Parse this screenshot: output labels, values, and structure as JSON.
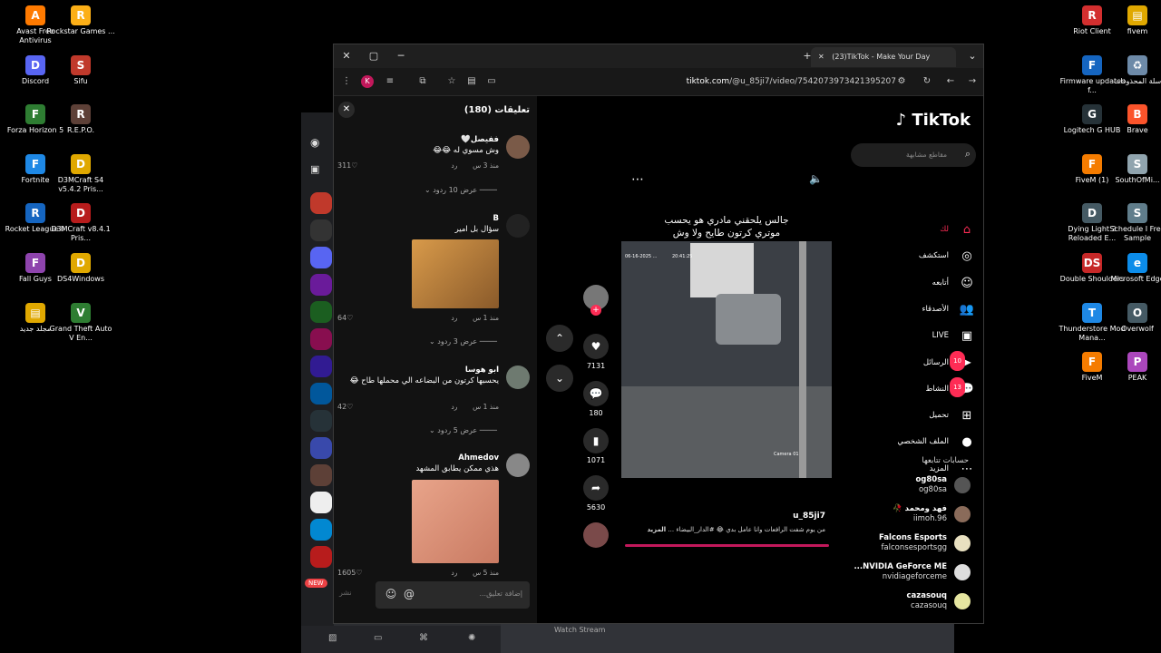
{
  "desktop_left": [
    {
      "label": "Avast Free Antivirus",
      "color": "#ff7a00",
      "glyph": "A"
    },
    {
      "label": "Rockstar Games ...",
      "color": "#fcaf17",
      "glyph": "R"
    },
    {
      "label": "Discord",
      "color": "#5865f2",
      "glyph": "D"
    },
    {
      "label": "Sifu",
      "color": "#c0392b",
      "glyph": "S"
    },
    {
      "label": "Forza Horizon 5",
      "color": "#2e7d32",
      "glyph": "F"
    },
    {
      "label": "R.E.P.O.",
      "color": "#5d4037",
      "glyph": "R"
    },
    {
      "label": "Fortnite",
      "color": "#1e88e5",
      "glyph": "F"
    },
    {
      "label": "D3MCraft S4 v5.4.2 Pris...",
      "color": "#e0a800",
      "glyph": "D"
    },
    {
      "label": "Rocket League®",
      "color": "#1565c0",
      "glyph": "R"
    },
    {
      "label": "D3MCraft v8.4.1 Pris...",
      "color": "#b71c1c",
      "glyph": "D"
    },
    {
      "label": "Fall Guys",
      "color": "#8e44ad",
      "glyph": "F"
    },
    {
      "label": "DS4Windows",
      "color": "#e0a800",
      "glyph": "D"
    },
    {
      "label": "مجلد جديد",
      "color": "#e0a800",
      "glyph": "▤"
    },
    {
      "label": "Grand Theft Auto V En...",
      "color": "#2e7d32",
      "glyph": "V"
    }
  ],
  "desktop_right": [
    {
      "label": "Riot Client",
      "color": "#d32f2f",
      "glyph": "R"
    },
    {
      "label": "fivem",
      "color": "#e0a800",
      "glyph": "▤"
    },
    {
      "label": "Firmware updater f...",
      "color": "#1565c0",
      "glyph": "F"
    },
    {
      "label": "سلة المحذوفات",
      "color": "#6d8aa8",
      "glyph": "♻"
    },
    {
      "label": "Logitech G HUB",
      "color": "#263238",
      "glyph": "G"
    },
    {
      "label": "Brave",
      "color": "#fb542b",
      "glyph": "B"
    },
    {
      "label": "FiveM (1)",
      "color": "#f57c00",
      "glyph": "F"
    },
    {
      "label": "SouthOfMi...",
      "color": "#90a4ae",
      "glyph": "S"
    },
    {
      "label": "Dying Light 2 Reloaded E...",
      "color": "#455a64",
      "glyph": "D"
    },
    {
      "label": "Schedule I Free Sample",
      "color": "#607d8b",
      "glyph": "S"
    },
    {
      "label": "Double Shoulders",
      "color": "#c62828",
      "glyph": "DS"
    },
    {
      "label": "Microsoft Edge",
      "color": "#0c8ce9",
      "glyph": "e"
    },
    {
      "label": "Thunderstore Mod Mana...",
      "color": "#1e88e5",
      "glyph": "T"
    },
    {
      "label": "Overwolf",
      "color": "#455a64",
      "glyph": "O"
    },
    {
      "label": "FiveM",
      "color": "#f57c00",
      "glyph": "F"
    },
    {
      "label": "PEAK",
      "color": "#ab47bc",
      "glyph": "P"
    }
  ],
  "browser": {
    "tab_title": "(23)TikTok - Make Your Day",
    "url_host": "tiktok.com",
    "url_path": "/@u_85ji7/video/7542073973421395207",
    "profile_initial": "K"
  },
  "discord": {
    "new_badge": "NEW",
    "watch_stream": "Watch Stream"
  },
  "comments": {
    "header": "تعليقات (180)",
    "items": [
      {
        "name": "ففيصل🤍",
        "text": "وش مسوي له 😂😂",
        "time": "منذ 3 س",
        "reply": "رد",
        "likes": "311",
        "replies": "عرض 10 ردود",
        "avatar": "#7a5a48"
      },
      {
        "name": "B",
        "text": "سؤال بل امير",
        "time": "منذ 1 س",
        "reply": "رد",
        "likes": "64",
        "replies": "عرض 3 ردود",
        "avatar": "#222"
      },
      {
        "name": "ابو هوسا",
        "text": "يحسبها كرتون من البضاعه الي محملها طاح 😂",
        "time": "منذ 1 س",
        "reply": "رد",
        "likes": "42",
        "replies": "عرض 5 ردود",
        "avatar": "#6e7a70"
      },
      {
        "name": "Ahmedov",
        "text": "هذي ممكن يطابق المشهد",
        "time": "منذ 5 س",
        "reply": "رد",
        "likes": "1605",
        "replies": "",
        "avatar": "#888"
      }
    ],
    "input_placeholder": "إضافة تعليق...",
    "post_label": "نشر"
  },
  "video": {
    "caption_line1": "جالس يلحقني مادري هو يحسب",
    "caption_line2": "موتري كرتون طايح ولا وش",
    "cam_date": "06-16-2025 ...",
    "cam_time": "20:41:25",
    "cam_label": "Camera 01",
    "username": "u_85ji7",
    "description": "من يوم شفت الرافعات وانا عامل بدي 😂 #الدار_البيضاء ...",
    "more": "المزيد",
    "counts": {
      "likes": "7131",
      "comments": "180",
      "saves": "1071",
      "shares": "5630"
    }
  },
  "sidebar": {
    "logo": "TikTok",
    "search_placeholder": "مقاطع مشابهة",
    "nav": [
      {
        "label": "لك",
        "icon": "⌂",
        "badge": "",
        "accent": true
      },
      {
        "label": "استكشف",
        "icon": "◎",
        "badge": ""
      },
      {
        "label": "أتابعه",
        "icon": "☺",
        "badge": ""
      },
      {
        "label": "الأصدقاء",
        "icon": "👥",
        "badge": ""
      },
      {
        "label": "LIVE",
        "icon": "▣",
        "badge": ""
      },
      {
        "label": "الرسائل",
        "icon": "➤",
        "badge": "10"
      },
      {
        "label": "النشاط",
        "icon": "💬",
        "badge": "13"
      },
      {
        "label": "تحميل",
        "icon": "⊞",
        "badge": ""
      },
      {
        "label": "الملف الشخصي",
        "icon": "●",
        "badge": ""
      },
      {
        "label": "المزيد",
        "icon": "⋯",
        "badge": ""
      }
    ],
    "following_title": "حسابات تتابعها",
    "following": [
      {
        "name": "og80sa",
        "user": "og80sa",
        "color": "#555"
      },
      {
        "name": "فهد ومحمد 🥀",
        "user": "iimoh.96",
        "color": "#8a6b5a"
      },
      {
        "name": "Falcons Esports",
        "user": "falconsesportsgg",
        "color": "#e8e0c0"
      },
      {
        "name": "NVIDIA GeForce ME...",
        "user": "nvidiageforceme",
        "color": "#ddd"
      },
      {
        "name": "cazasouq",
        "user": "cazasouq",
        "color": "#e6e6a0"
      }
    ]
  }
}
